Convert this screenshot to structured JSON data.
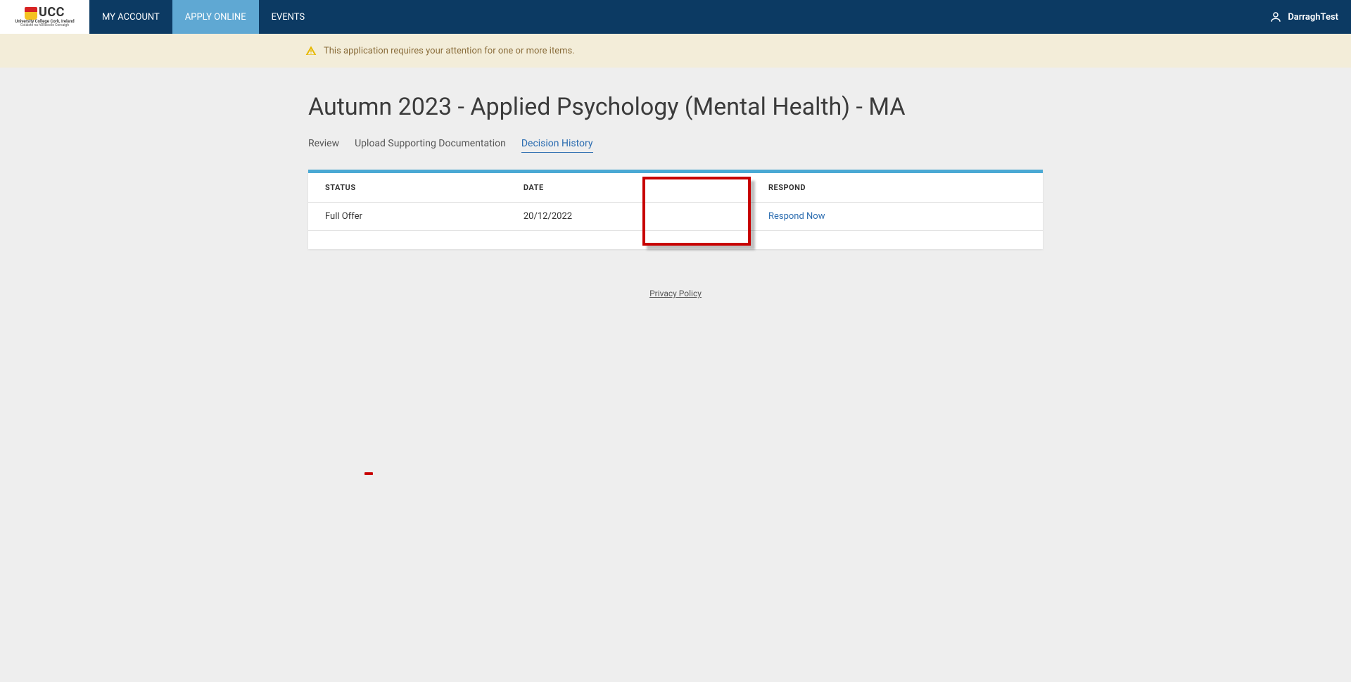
{
  "header": {
    "logo_text": "UCC",
    "logo_sub1": "University College Cork, Ireland",
    "logo_sub2": "Coláiste na hOllscoile Corcaigh",
    "nav_my_account": "MY ACCOUNT",
    "nav_apply_online": "APPLY ONLINE",
    "nav_events": "EVENTS",
    "user_name": "DarraghTest"
  },
  "alert": {
    "text": "This application requires your attention for one or more items."
  },
  "page_title": "Autumn 2023 - Applied Psychology (Mental Health) - MA",
  "tabs": {
    "review": "Review",
    "upload": "Upload Supporting Documentation",
    "decision": "Decision History"
  },
  "table": {
    "col_status": "STATUS",
    "col_date": "DATE",
    "col_respond": "RESPOND",
    "rows": [
      {
        "status": "Full Offer",
        "date": "20/12/2022",
        "respond_label": "Respond Now"
      }
    ]
  },
  "footer": {
    "privacy": "Privacy Policy"
  },
  "colors": {
    "header_bg": "#0c3a63",
    "active_nav": "#5fa8d3",
    "card_accent": "#4aa9d4",
    "link": "#2b6cb0",
    "alert_bg": "#f3edd9",
    "highlight": "#c80000"
  }
}
